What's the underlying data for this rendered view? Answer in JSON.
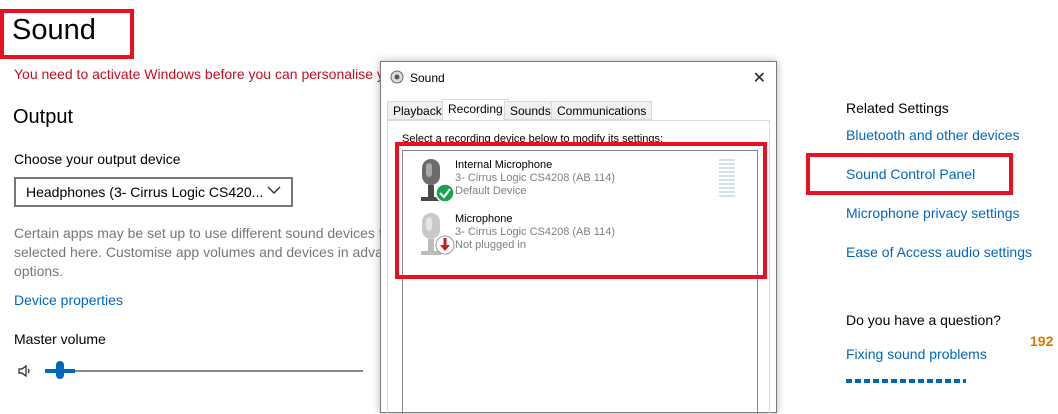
{
  "settings": {
    "page_title": "Sound",
    "activation_warning": "You need to activate Windows before you can personalise y",
    "output_heading": "Output",
    "choose_output_label": "Choose your output device",
    "output_device_selected": "Headphones (3- Cirrus Logic CS420...",
    "description_line1": "Certain apps may be set up to use different sound devices t",
    "description_line2": "selected here. Customise app volumes and devices in advar",
    "description_line3": "options.",
    "device_properties_link": "Device properties",
    "master_volume_label": "Master volume",
    "master_volume_level": 0.05
  },
  "related": {
    "heading": "Related Settings",
    "links": [
      "Bluetooth and other devices",
      "Sound Control Panel",
      "Microphone privacy settings",
      "Ease of Access audio settings"
    ],
    "question_heading": "Do you have a question?",
    "help_link": "Fixing sound problems",
    "overflow_number": "192"
  },
  "dialog": {
    "title": "Sound",
    "close_glyph": "✕",
    "tabs": [
      "Playback",
      "Recording",
      "Sounds",
      "Communications"
    ],
    "active_tab": "Recording",
    "instruction": "Select a recording device below to modify its settings:",
    "devices": [
      {
        "name": "Internal Microphone",
        "driver": "3- Cirrus Logic CS4208 (AB 114)",
        "status": "Default Device"
      },
      {
        "name": "Microphone",
        "driver": "3- Cirrus Logic CS4208 (AB 114)",
        "status": "Not plugged in"
      }
    ]
  },
  "colors": {
    "accent": "#0067c0",
    "highlight_box": "#e81123",
    "warning": "#c50f1f",
    "default_badge": "#16a34a",
    "unplugged_badge": "#d11a1a"
  }
}
